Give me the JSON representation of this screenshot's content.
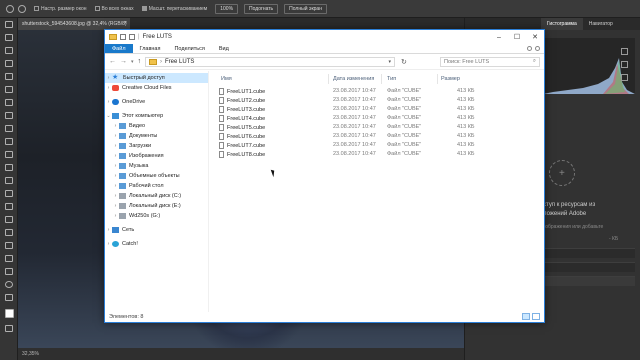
{
  "photoshop": {
    "options": {
      "fit_label": "Настр. размер окон",
      "all_windows_label": "Во всех окнах",
      "scrubby_label": "Масшт. перетаскиванием",
      "zoom_value": "100%",
      "fit_button": "Подогнать",
      "fill_button": "Полный экран"
    },
    "document_tab": "shutterstock_594543608.jpg @ 32,4% (RGB/8)",
    "status_zoom": "32,35%",
    "panels": {
      "tabs": [
        "Гистограмма",
        "Навигатор"
      ],
      "cc_text_1": "ступ к ресурсам из",
      "cc_text_2": "ложений Adobe",
      "cc_text_3": "зображения или добавьте",
      "kb": "- КБ"
    }
  },
  "explorer": {
    "title": "Free LUTS",
    "window_buttons": [
      "–",
      "☐",
      "✕"
    ],
    "ribbon": [
      "Файл",
      "Главная",
      "Поделиться",
      "Вид"
    ],
    "address": {
      "path": "Free LUTS",
      "search_placeholder": "Поиск: Free LUTS"
    },
    "nav": [
      {
        "label": "Быстрый доступ",
        "icon": "star-icon",
        "selected": true
      },
      {
        "label": "Creative Cloud Files",
        "icon": "creative-cloud-icon"
      },
      {
        "label": "OneDrive",
        "icon": "onedrive-icon"
      },
      {
        "label": "Этот компьютер",
        "icon": "computer-icon"
      },
      {
        "label": "Видео",
        "icon": "video-folder-icon"
      },
      {
        "label": "Документы",
        "icon": "documents-folder-icon"
      },
      {
        "label": "Загрузки",
        "icon": "downloads-folder-icon"
      },
      {
        "label": "Изображения",
        "icon": "pictures-folder-icon"
      },
      {
        "label": "Музыка",
        "icon": "music-folder-icon"
      },
      {
        "label": "Объемные объекты",
        "icon": "3d-objects-folder-icon"
      },
      {
        "label": "Рабочий стол",
        "icon": "desktop-folder-icon"
      },
      {
        "label": "Локальный диск (C:)",
        "icon": "drive-icon"
      },
      {
        "label": "Локальный диск (E:)",
        "icon": "drive-icon"
      },
      {
        "label": "Wd250s (G:)",
        "icon": "drive-icon"
      },
      {
        "label": "Сеть",
        "icon": "network-icon"
      },
      {
        "label": "Catch!",
        "icon": "catch-icon"
      }
    ],
    "columns": {
      "name": "Имя",
      "date": "Дата изменения",
      "type": "Тип",
      "size": "Размер"
    },
    "files": [
      {
        "name": "FreeLUT1.cube",
        "date": "23.08.2017 10:47",
        "type": "Файл \"CUBE\"",
        "size": "413 КБ"
      },
      {
        "name": "FreeLUT2.cube",
        "date": "23.08.2017 10:47",
        "type": "Файл \"CUBE\"",
        "size": "413 КБ"
      },
      {
        "name": "FreeLUT3.cube",
        "date": "23.08.2017 10:47",
        "type": "Файл \"CUBE\"",
        "size": "413 КБ"
      },
      {
        "name": "FreeLUT4.cube",
        "date": "23.08.2017 10:47",
        "type": "Файл \"CUBE\"",
        "size": "413 КБ"
      },
      {
        "name": "FreeLUT5.cube",
        "date": "23.08.2017 10:47",
        "type": "Файл \"CUBE\"",
        "size": "413 КБ"
      },
      {
        "name": "FreeLUT6.cube",
        "date": "23.08.2017 10:47",
        "type": "Файл \"CUBE\"",
        "size": "413 КБ"
      },
      {
        "name": "FreeLUT7.cube",
        "date": "23.08.2017 10:47",
        "type": "Файл \"CUBE\"",
        "size": "413 КБ"
      },
      {
        "name": "FreeLUT8.cube",
        "date": "23.08.2017 10:47",
        "type": "Файл \"CUBE\"",
        "size": "413 КБ"
      }
    ],
    "status": "Элементов: 8"
  }
}
